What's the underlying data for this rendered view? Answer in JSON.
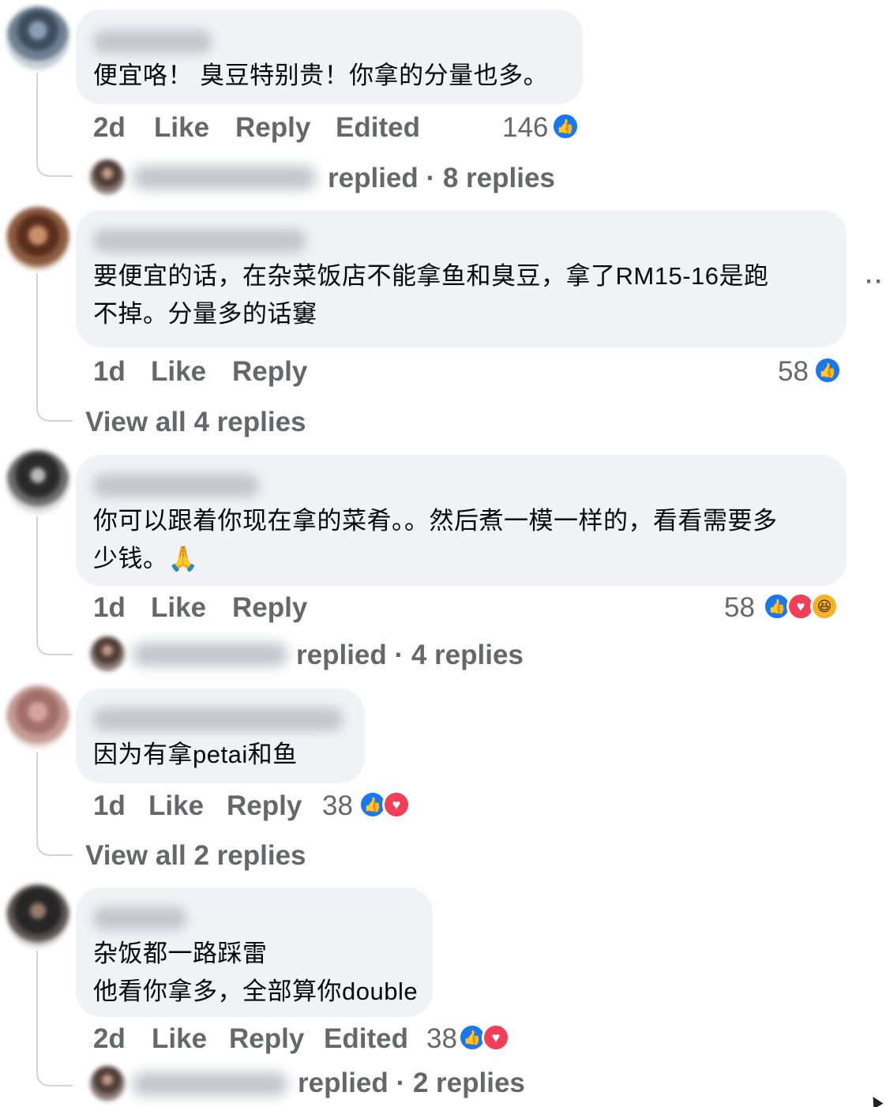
{
  "comments": [
    {
      "text": "便宜咯！  臭豆特别贵！你拿的分量也多。",
      "time": "2d",
      "like_label": "Like",
      "reply_label": "Reply",
      "edited_label": "Edited",
      "reaction_count": "146",
      "reactions": [
        "like-icon"
      ],
      "replies_summary": "replied · 8 replies"
    },
    {
      "text": "要便宜的话，在杂菜饭店不能拿鱼和臭豆，拿了RM15-16是跑\n不掉。分量多的话窶",
      "time": "1d",
      "like_label": "Like",
      "reply_label": "Reply",
      "reaction_count": "58",
      "reactions": [
        "like-icon"
      ],
      "view_all_label": "View all 4 replies",
      "more_label": "···"
    },
    {
      "text": "你可以跟着你现在拿的菜肴。。然后煮一模一样的，看看需要多\n少钱。🙏",
      "time": "1d",
      "like_label": "Like",
      "reply_label": "Reply",
      "reaction_count": "58",
      "reactions": [
        "like-icon",
        "love-icon",
        "haha-icon"
      ],
      "replies_summary": "replied · 4 replies"
    },
    {
      "text": "因为有拿petai和鱼",
      "time": "1d",
      "like_label": "Like",
      "reply_label": "Reply",
      "reaction_count": "38",
      "reactions": [
        "like-icon",
        "love-icon"
      ],
      "view_all_label": "View all 2 replies"
    },
    {
      "text": "杂饭都一路踩雷\n他看你拿多，全部算你double",
      "time": "2d",
      "like_label": "Like",
      "reply_label": "Reply",
      "edited_label": "Edited",
      "reaction_count": "38",
      "reactions": [
        "like-icon",
        "love-icon"
      ],
      "replies_summary": "replied · 2 replies"
    }
  ],
  "colors": {
    "bubble": "#f0f2f5",
    "secondary_text": "#65676b",
    "like_blue": "#1877f2",
    "love_red": "#f33e58",
    "haha_yellow": "#f7b125"
  }
}
